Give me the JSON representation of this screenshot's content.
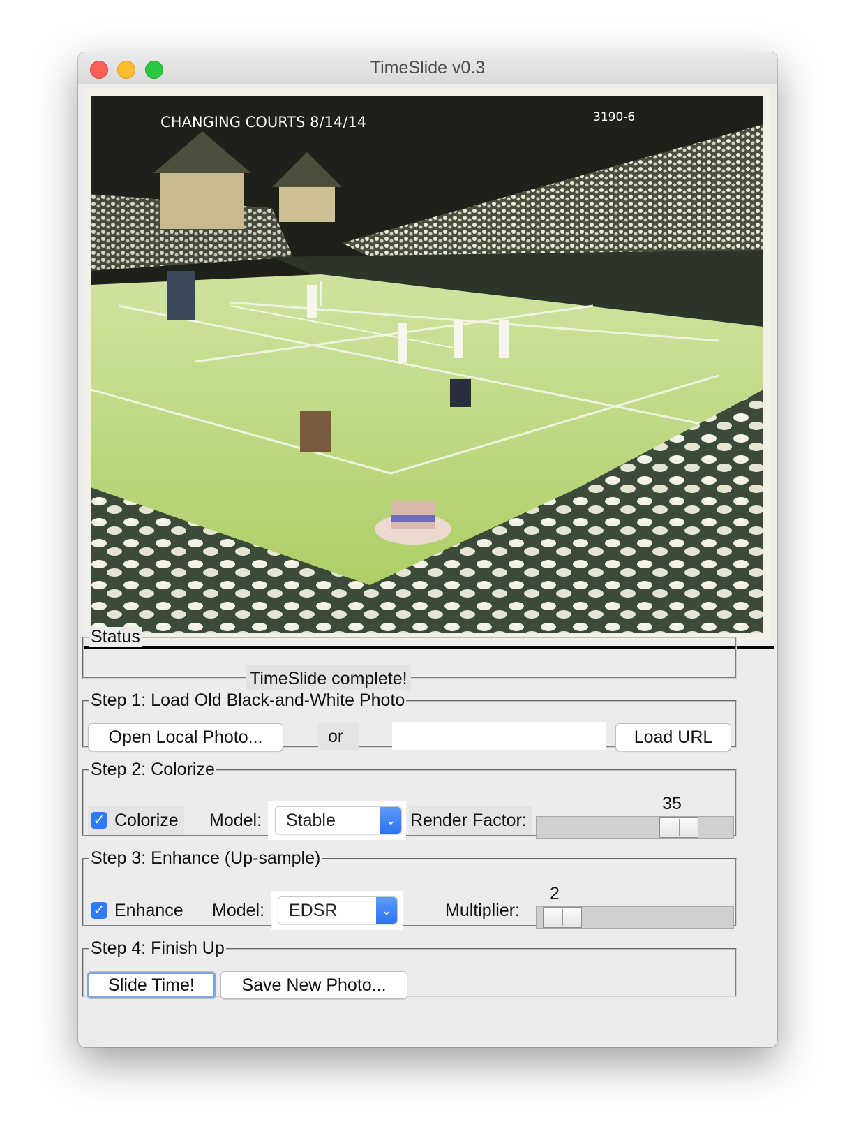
{
  "window": {
    "title": "TimeSlide v0.3"
  },
  "photo": {
    "caption": "CHANGING COURTS 8/14/14",
    "plate_number": "3190-6"
  },
  "status": {
    "legend": "Status",
    "text": "TimeSlide complete!"
  },
  "step1": {
    "legend": "Step 1: Load Old Black-and-White Photo",
    "open_button": "Open Local Photo...",
    "or_label": "or",
    "url_value": "",
    "url_placeholder": "",
    "load_url_button": "Load URL"
  },
  "step2": {
    "legend": "Step 2: Colorize",
    "checkbox_label": "Colorize",
    "checked": true,
    "model_label": "Model:",
    "model_value": "Stable",
    "render_factor_label": "Render Factor:",
    "render_factor_value": "35",
    "render_factor_fraction": 0.78
  },
  "step3": {
    "legend": "Step 3: Enhance (Up-sample)",
    "checkbox_label": "Enhance",
    "checked": true,
    "model_label": "Model:",
    "model_value": "EDSR",
    "multiplier_label": "Multiplier:",
    "multiplier_value": "2",
    "multiplier_fraction": 0.04
  },
  "step4": {
    "legend": "Step 4: Finish Up",
    "slide_button": "Slide Time!",
    "save_button": "Save New Photo..."
  },
  "icons": {
    "checkmark": "checkmark-icon",
    "dropdown": "chevron-down-icon"
  },
  "colors": {
    "accent": "#2d7cf6",
    "close": "#fe5f57",
    "minimize": "#febc2e",
    "maximize": "#28c840"
  }
}
